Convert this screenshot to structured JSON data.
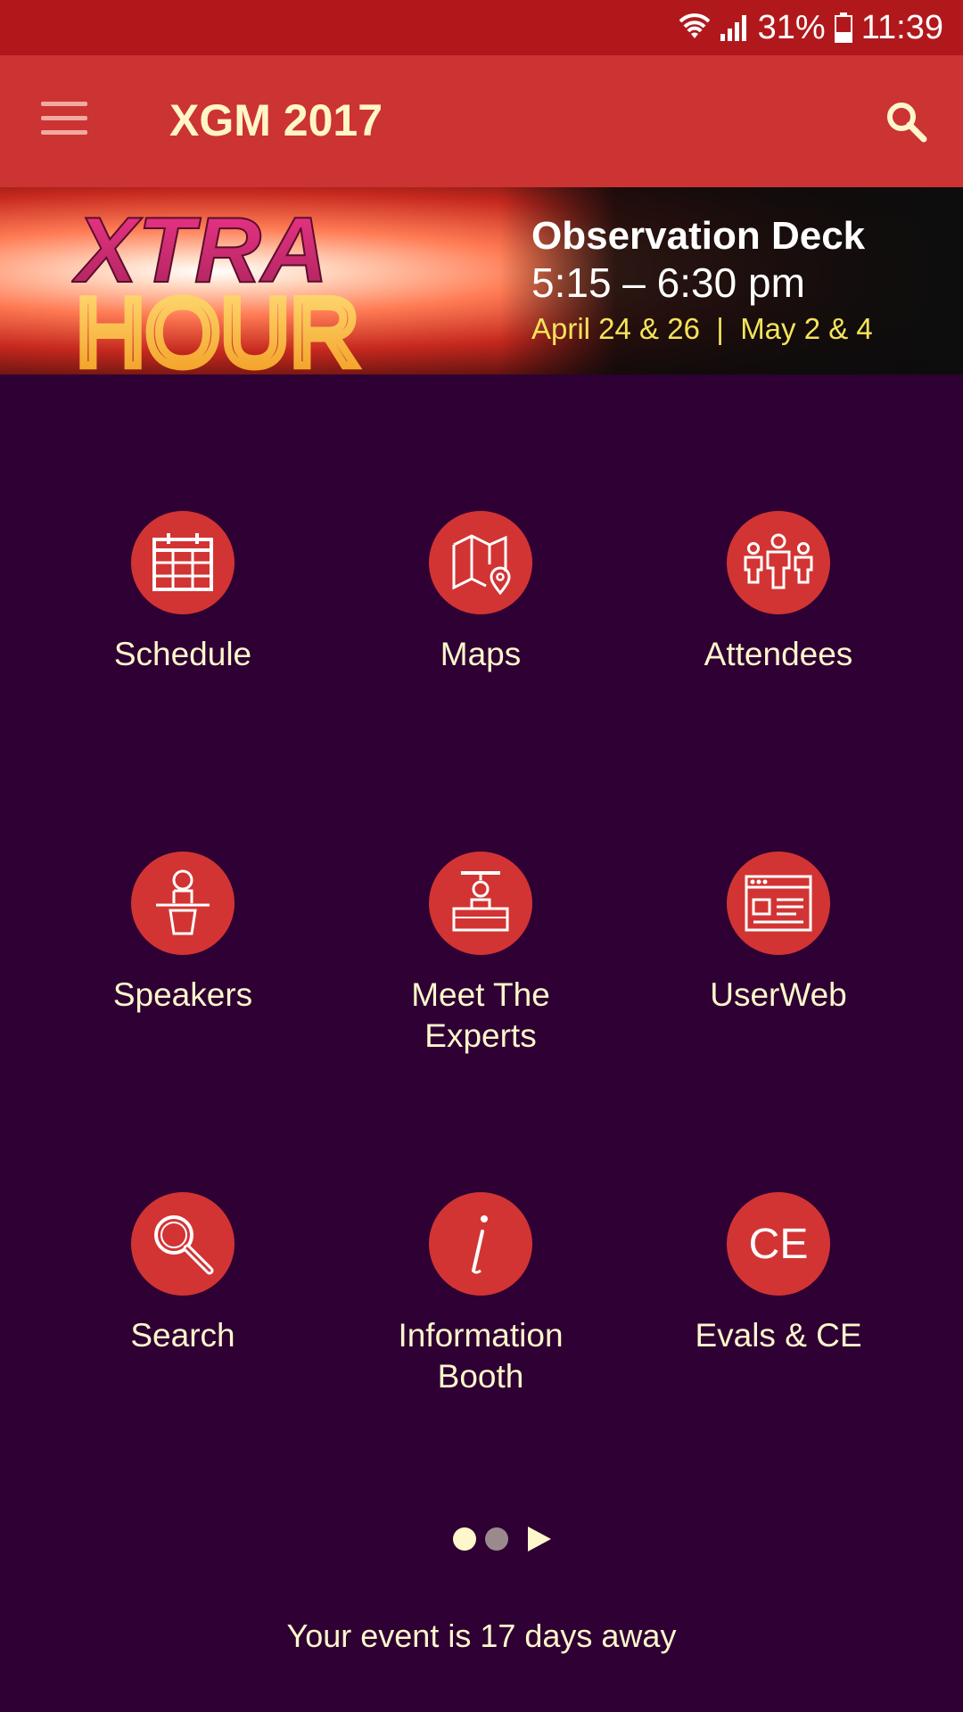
{
  "status_bar": {
    "battery": "31%",
    "time": "11:39",
    "icons": [
      "wifi-icon",
      "signal-icon",
      "battery-icon"
    ]
  },
  "app_bar": {
    "title": "XGM 2017",
    "icons": [
      "menu-icon",
      "search-icon"
    ]
  },
  "banner": {
    "logo_text_top": "XTRA",
    "logo_text_bottom": "HOUR",
    "title": "Observation Deck",
    "time": "5:15 – 6:30 pm",
    "dates": "April 24 & 26  |  May 2 & 4"
  },
  "tiles": [
    {
      "label": "Schedule",
      "icon": "calendar-icon"
    },
    {
      "label": "Maps",
      "icon": "map-icon"
    },
    {
      "label": "Attendees",
      "icon": "attendees-icon"
    },
    {
      "label": "Speakers",
      "icon": "speaker-podium-icon"
    },
    {
      "label": "Meet The Experts",
      "icon": "expert-desk-icon"
    },
    {
      "label": "UserWeb",
      "icon": "browser-window-icon"
    },
    {
      "label": "Search",
      "icon": "magnifier-icon"
    },
    {
      "label": "Information Booth",
      "icon": "info-icon"
    },
    {
      "label": "Evals & CE",
      "icon": "ce-icon"
    }
  ],
  "ce_icon_text": "CE",
  "pager": {
    "pages": 2,
    "current": 1
  },
  "countdown": "Your event is 17 days away",
  "colors": {
    "status_bar": "#b1181c",
    "app_bar": "#cc3333",
    "background": "#2e0033",
    "accent_circle": "#d23433",
    "text_cream": "#fff6cc"
  }
}
